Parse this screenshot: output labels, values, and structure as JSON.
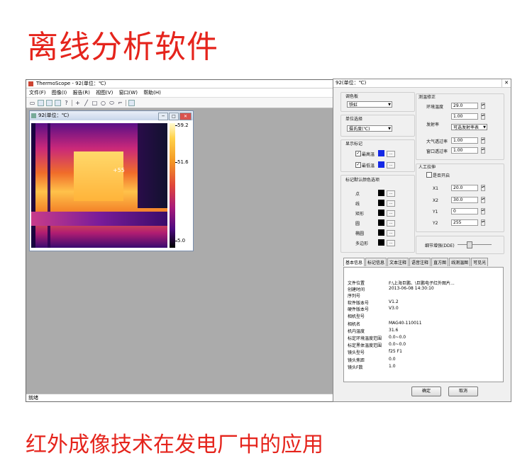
{
  "headline": "离线分析软件",
  "subline": "红外成像技术在发电厂中的应用",
  "app": {
    "title": "ThermoScope - 92(单位：℃)",
    "menu": [
      "文件(F)",
      "图像(I)",
      "报告(R)",
      "视图(V)",
      "窗口(W)",
      "帮助(H)"
    ],
    "status": "就绪"
  },
  "child": {
    "title": "92(单位：℃)",
    "max": "59.2",
    "mid": "51.6",
    "min": "5.0",
    "marker": "+55"
  },
  "panel": {
    "title": "92(单位：℃)",
    "palette_label": "调色板",
    "palette_value": "铁虹",
    "unit_label": "单位选择",
    "unit_value": "摄氏度(℃)",
    "display_label": "显示标记",
    "max_label": "最高温",
    "min_label": "最低温",
    "default_color_label": "标记默认颜色选项",
    "color_items": [
      "点",
      "线",
      "矩形",
      "圆",
      "椭圆",
      "多边形"
    ],
    "correction_label": "测温修正",
    "ambient_label": "环境温度",
    "ambient_value": "29.0",
    "emissivity_label": "发射率",
    "emissivity_value": "1.00",
    "emissivity_select": "可选发射率表",
    "atm_label": "大气透过率",
    "atm_value": "1.00",
    "window_label": "窗口透过率",
    "window_value": "1.00",
    "manual_label": "人工拉伸",
    "enable_label": "是否开启",
    "x1_label": "X1",
    "x1_value": "20.0",
    "x2_label": "X2",
    "x2_value": "30.0",
    "y1_label": "Y1",
    "y1_value": "0",
    "y2_label": "Y2",
    "y2_value": "255",
    "dde_label": "细节增强(DDE)",
    "tabs": [
      "基本信息",
      "标记信息",
      "文本注释",
      "语音注释",
      "直方图",
      "线测温图",
      "可见光"
    ],
    "info": [
      {
        "k": "文件位置",
        "v": "F:\\上海巨鹏、\\巨鹏电子红外图片..."
      },
      {
        "k": "创建时间",
        "v": "2013-06-08 14:30:10"
      },
      {
        "k": "序列号",
        "v": ""
      },
      {
        "k": "软件版本号",
        "v": "V1.2"
      },
      {
        "k": "硬件版本号",
        "v": "V3.0"
      },
      {
        "k": "相机型号",
        "v": ""
      },
      {
        "k": "相机名",
        "v": "MAG40-110011"
      },
      {
        "k": "机内温度",
        "v": "31.6"
      },
      {
        "k": "标定环境温度范围",
        "v": "0.0~0.0"
      },
      {
        "k": "标定黑体温度范围",
        "v": "0.0~0.0"
      },
      {
        "k": "镜头型号",
        "v": "f25 F1"
      },
      {
        "k": "镜头焦距",
        "v": "0.0"
      },
      {
        "k": "镜头F数",
        "v": "1.0"
      }
    ],
    "ok": "确定",
    "cancel": "取消"
  }
}
